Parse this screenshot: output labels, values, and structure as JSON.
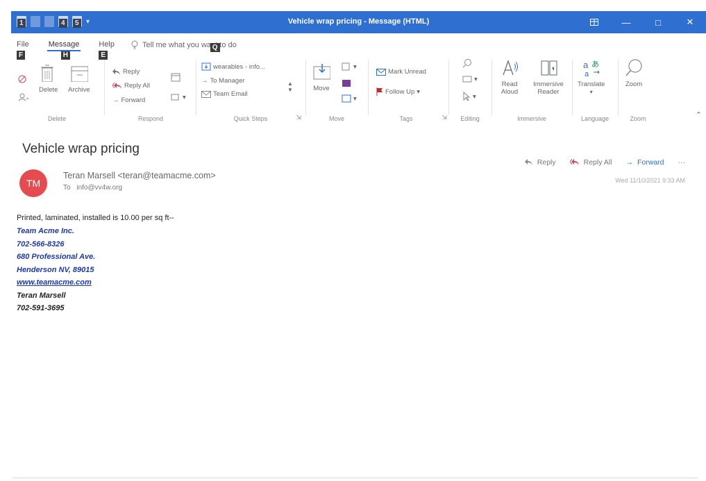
{
  "window": {
    "title": "Vehicle wrap pricing  -  Message (HTML)",
    "qat_keytips": [
      "1",
      "4",
      "5"
    ]
  },
  "tabs": [
    {
      "label": "File",
      "keytip": "F"
    },
    {
      "label": "Message",
      "keytip": "H"
    },
    {
      "label": "Help",
      "keytip": "E"
    }
  ],
  "tell_me": {
    "text": "Tell me what you want to do",
    "keytip": "Q"
  },
  "ribbon": {
    "delete": {
      "delete_label": "Delete",
      "archive_label": "Archive",
      "group": "Delete"
    },
    "respond": {
      "reply": "Reply",
      "reply_all": "Reply All",
      "forward": "Forward",
      "group": "Respond"
    },
    "quick_steps": {
      "items": [
        "wearables - info...",
        "To Manager",
        "Team Email"
      ],
      "group": "Quick Steps"
    },
    "move": {
      "move_label": "Move",
      "group": "Move"
    },
    "tags": {
      "mark_unread": "Mark Unread",
      "follow_up": "Follow Up",
      "group": "Tags"
    },
    "editing": {
      "group": "Editing"
    },
    "immersive": {
      "read_aloud": "Read Aloud",
      "immersive_reader": "Immersive Reader",
      "group": "Immersive"
    },
    "language": {
      "translate": "Translate",
      "group": "Language"
    },
    "zoom": {
      "zoom_label": "Zoom",
      "group": "Zoom"
    }
  },
  "message": {
    "subject": "Vehicle wrap pricing",
    "avatar_initials": "TM",
    "sender": "Teran Marsell <teran@teamacme.com>",
    "to_label": "To",
    "to": "info@vv4w.org",
    "date": "Wed 11/10/2021 9:33 AM",
    "actions": {
      "reply": "Reply",
      "reply_all": "Reply All",
      "forward": "Forward"
    },
    "body_text": "Printed, laminated, installed is 10.00 per sq ft--",
    "signature": {
      "company": "Team Acme Inc.",
      "phone1": "702-566-8326",
      "address1": "680 Professional Ave.",
      "address2": "Henderson NV, 89015",
      "website": "www.teamacme.com",
      "name": "Teran Marsell",
      "phone2": "702-591-3695"
    }
  },
  "colors": {
    "accent": "#2f6fd0",
    "avatar": "#e54b4f",
    "signature_blue": "#1f3aa6"
  }
}
